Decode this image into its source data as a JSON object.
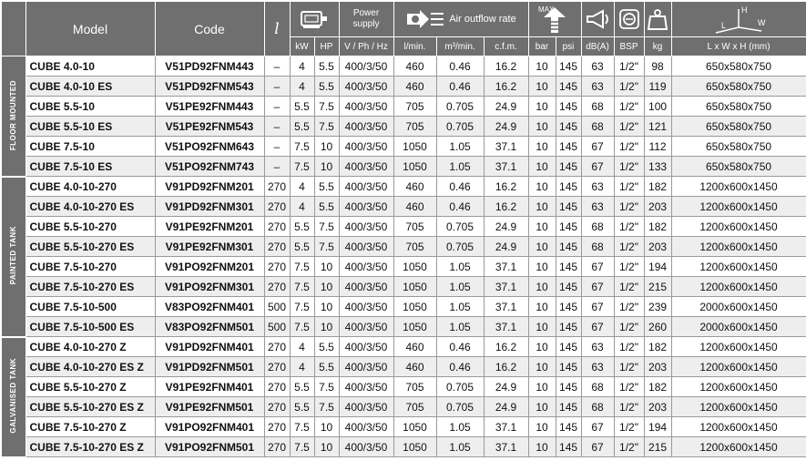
{
  "headers": {
    "model": "Model",
    "code": "Code",
    "litre": "l",
    "power_supply": "Power supply",
    "air_outflow": "Air outflow rate",
    "max": "MAX"
  },
  "units": {
    "kw": "kW",
    "hp": "HP",
    "vphhz": "V / Ph / Hz",
    "lmin": "l/min.",
    "m3min": "m³/min.",
    "cfm": "c.f.m.",
    "bar": "bar",
    "psi": "psi",
    "dba": "dB(A)",
    "bsp": "BSP",
    "kg": "kg",
    "dims": "L x W x H (mm)"
  },
  "icon_labels": {
    "h": "H",
    "l": "L",
    "w": "W"
  },
  "groups": [
    {
      "label": "FLOOR MOUNTED",
      "rows": [
        [
          "CUBE 4.0-10",
          "V51PD92FNM443",
          "–",
          "4",
          "5.5",
          "400/3/50",
          "460",
          "0.46",
          "16.2",
          "10",
          "145",
          "63",
          "1/2\"",
          "98",
          "650x580x750"
        ],
        [
          "CUBE 4.0-10 ES",
          "V51PD92FNM543",
          "–",
          "4",
          "5.5",
          "400/3/50",
          "460",
          "0.46",
          "16.2",
          "10",
          "145",
          "63",
          "1/2\"",
          "119",
          "650x580x750"
        ],
        [
          "CUBE 5.5-10",
          "V51PE92FNM443",
          "–",
          "5.5",
          "7.5",
          "400/3/50",
          "705",
          "0.705",
          "24.9",
          "10",
          "145",
          "68",
          "1/2\"",
          "100",
          "650x580x750"
        ],
        [
          "CUBE 5.5-10 ES",
          "V51PE92FNM543",
          "–",
          "5.5",
          "7.5",
          "400/3/50",
          "705",
          "0.705",
          "24.9",
          "10",
          "145",
          "68",
          "1/2\"",
          "121",
          "650x580x750"
        ],
        [
          "CUBE 7.5-10",
          "V51PO92FNM643",
          "–",
          "7.5",
          "10",
          "400/3/50",
          "1050",
          "1.05",
          "37.1",
          "10",
          "145",
          "67",
          "1/2\"",
          "112",
          "650x580x750"
        ],
        [
          "CUBE 7.5-10 ES",
          "V51PO92FNM743",
          "–",
          "7.5",
          "10",
          "400/3/50",
          "1050",
          "1.05",
          "37.1",
          "10",
          "145",
          "67",
          "1/2\"",
          "133",
          "650x580x750"
        ]
      ]
    },
    {
      "label": "PAINTED TANK",
      "rows": [
        [
          "CUBE 4.0-10-270",
          "V91PD92FNM201",
          "270",
          "4",
          "5.5",
          "400/3/50",
          "460",
          "0.46",
          "16.2",
          "10",
          "145",
          "63",
          "1/2\"",
          "182",
          "1200x600x1450"
        ],
        [
          "CUBE 4.0-10-270 ES",
          "V91PD92FNM301",
          "270",
          "4",
          "5.5",
          "400/3/50",
          "460",
          "0.46",
          "16.2",
          "10",
          "145",
          "63",
          "1/2\"",
          "203",
          "1200x600x1450"
        ],
        [
          "CUBE 5.5-10-270",
          "V91PE92FNM201",
          "270",
          "5.5",
          "7.5",
          "400/3/50",
          "705",
          "0.705",
          "24.9",
          "10",
          "145",
          "68",
          "1/2\"",
          "182",
          "1200x600x1450"
        ],
        [
          "CUBE 5.5-10-270 ES",
          "V91PE92FNM301",
          "270",
          "5.5",
          "7.5",
          "400/3/50",
          "705",
          "0.705",
          "24.9",
          "10",
          "145",
          "68",
          "1/2\"",
          "203",
          "1200x600x1450"
        ],
        [
          "CUBE 7.5-10-270",
          "V91PO92FNM201",
          "270",
          "7.5",
          "10",
          "400/3/50",
          "1050",
          "1.05",
          "37.1",
          "10",
          "145",
          "67",
          "1/2\"",
          "194",
          "1200x600x1450"
        ],
        [
          "CUBE 7.5-10-270 ES",
          "V91PO92FNM301",
          "270",
          "7.5",
          "10",
          "400/3/50",
          "1050",
          "1.05",
          "37.1",
          "10",
          "145",
          "67",
          "1/2\"",
          "215",
          "1200x600x1450"
        ],
        [
          "CUBE 7.5-10-500",
          "V83PO92FNM401",
          "500",
          "7.5",
          "10",
          "400/3/50",
          "1050",
          "1.05",
          "37.1",
          "10",
          "145",
          "67",
          "1/2\"",
          "239",
          "2000x600x1450"
        ],
        [
          "CUBE 7.5-10-500 ES",
          "V83PO92FNM501",
          "500",
          "7.5",
          "10",
          "400/3/50",
          "1050",
          "1.05",
          "37.1",
          "10",
          "145",
          "67",
          "1/2\"",
          "260",
          "2000x600x1450"
        ]
      ]
    },
    {
      "label": "GALVANISED TANK",
      "rows": [
        [
          "CUBE 4.0-10-270 Z",
          "V91PD92FNM401",
          "270",
          "4",
          "5.5",
          "400/3/50",
          "460",
          "0.46",
          "16.2",
          "10",
          "145",
          "63",
          "1/2\"",
          "182",
          "1200x600x1450"
        ],
        [
          "CUBE 4.0-10-270 ES Z",
          "V91PD92FNM501",
          "270",
          "4",
          "5.5",
          "400/3/50",
          "460",
          "0.46",
          "16.2",
          "10",
          "145",
          "63",
          "1/2\"",
          "203",
          "1200x600x1450"
        ],
        [
          "CUBE 5.5-10-270 Z",
          "V91PE92FNM401",
          "270",
          "5.5",
          "7.5",
          "400/3/50",
          "705",
          "0.705",
          "24.9",
          "10",
          "145",
          "68",
          "1/2\"",
          "182",
          "1200x600x1450"
        ],
        [
          "CUBE 5.5-10-270 ES Z",
          "V91PE92FNM501",
          "270",
          "5.5",
          "7.5",
          "400/3/50",
          "705",
          "0.705",
          "24.9",
          "10",
          "145",
          "68",
          "1/2\"",
          "203",
          "1200x600x1450"
        ],
        [
          "CUBE 7.5-10-270 Z",
          "V91PO92FNM401",
          "270",
          "7.5",
          "10",
          "400/3/50",
          "1050",
          "1.05",
          "37.1",
          "10",
          "145",
          "67",
          "1/2\"",
          "194",
          "1200x600x1450"
        ],
        [
          "CUBE 7.5-10-270 ES Z",
          "V91PO92FNM501",
          "270",
          "7.5",
          "10",
          "400/3/50",
          "1050",
          "1.05",
          "37.1",
          "10",
          "145",
          "67",
          "1/2\"",
          "215",
          "1200x600x1450"
        ]
      ]
    }
  ],
  "colors": {
    "header_bg": "#6f6f6f",
    "row_alt": "#eeeeee"
  }
}
